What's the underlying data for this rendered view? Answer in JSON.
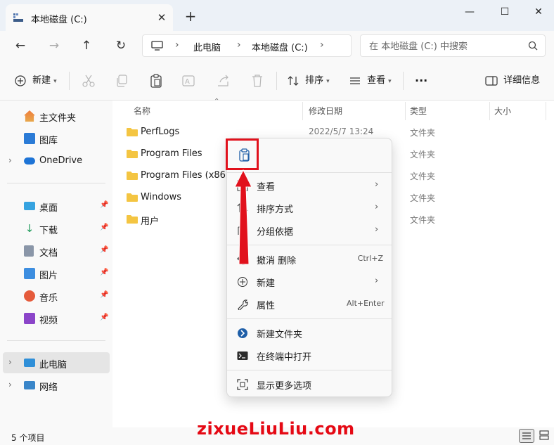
{
  "window": {
    "tab_title": "本地磁盘 (C:)",
    "new_tab": "+",
    "minimize": "—",
    "maximize": "☐",
    "close": "✕"
  },
  "nav": {
    "back": "←",
    "forward": "→",
    "up": "↑",
    "refresh": "↻"
  },
  "address": {
    "breadcrumbs": [
      "此电脑",
      "本地磁盘 (C:)"
    ],
    "separator": "›"
  },
  "search": {
    "placeholder": "在 本地磁盘 (C:) 中搜索"
  },
  "toolbar": {
    "new_label": "新建",
    "sort_label": "排序",
    "view_label": "查看",
    "more_label": "···",
    "details_label": "详细信息"
  },
  "sidebar": {
    "items": [
      {
        "label": "主文件夹",
        "icon": "home-icon"
      },
      {
        "label": "图库",
        "icon": "gallery-icon"
      },
      {
        "label": "OneDrive",
        "icon": "onedrive-icon"
      },
      {
        "label": "桌面",
        "icon": "desktop-icon"
      },
      {
        "label": "下载",
        "icon": "download-icon"
      },
      {
        "label": "文档",
        "icon": "document-icon"
      },
      {
        "label": "图片",
        "icon": "pictures-icon"
      },
      {
        "label": "音乐",
        "icon": "music-icon"
      },
      {
        "label": "视频",
        "icon": "video-icon"
      },
      {
        "label": "此电脑",
        "icon": "pc-icon"
      },
      {
        "label": "网络",
        "icon": "network-icon"
      }
    ]
  },
  "columns": {
    "name": "名称",
    "modified": "修改日期",
    "type": "类型",
    "size": "大小"
  },
  "files": [
    {
      "name": "PerfLogs",
      "date": "2022/5/7 13:24",
      "type": "文件夹"
    },
    {
      "name": "Program Files",
      "date": "",
      "type": "文件夹"
    },
    {
      "name": "Program Files (x86)",
      "date": "",
      "type": "文件夹"
    },
    {
      "name": "Windows",
      "date": "",
      "type": "文件夹"
    },
    {
      "name": "用户",
      "date": "",
      "type": "文件夹"
    }
  ],
  "status": {
    "count": "5 个项目"
  },
  "context_menu": {
    "view": "查看",
    "sort": "排序方式",
    "group": "分组依据",
    "undo": "撤消 删除",
    "undo_shortcut": "Ctrl+Z",
    "new": "新建",
    "properties": "属性",
    "properties_shortcut": "Alt+Enter",
    "new_folder": "新建文件夹",
    "open_terminal": "在终端中打开",
    "more_options": "显示更多选项",
    "arrow": "›"
  },
  "watermark": "zixueLiuLiu.com",
  "colors": {
    "accent": "#0067c0",
    "folder": "#f4c542",
    "annotation_red": "#e1111c"
  }
}
